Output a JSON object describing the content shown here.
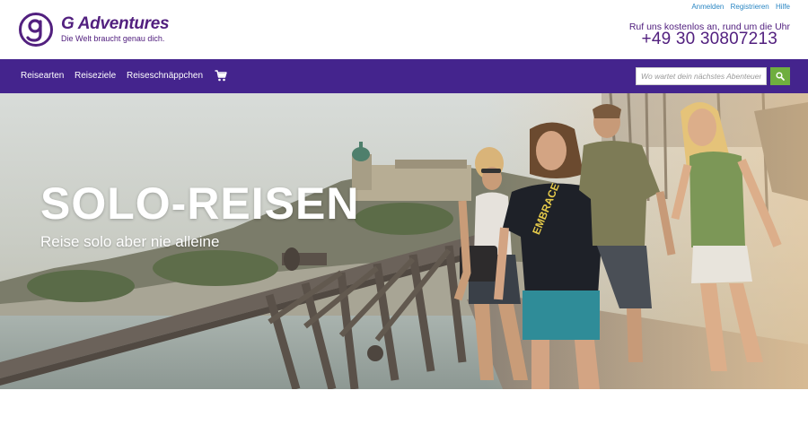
{
  "brand": {
    "name": "G Adventures",
    "tagline": "Die Welt braucht genau dich.",
    "color": "#52207f"
  },
  "top_links": [
    "Anmelden",
    "Registrieren",
    "Hilfe"
  ],
  "contact": {
    "hint": "Ruf uns kostenlos an, rund um die Uhr",
    "phone": "+49 30 30807213"
  },
  "nav": {
    "background": "#44248d",
    "items": [
      "Reisearten",
      "Reiseziele",
      "Reiseschnäppchen"
    ],
    "cart_icon": "shopping-cart-icon"
  },
  "search": {
    "placeholder": "Wo wartet dein nächstes Abenteuer?",
    "button_icon": "search-icon",
    "button_color": "#6fae3f"
  },
  "hero": {
    "title": "SOLO-REISEN",
    "subtitle": "Reise solo aber nie alleine",
    "shirt_text": "EMBRACE"
  }
}
